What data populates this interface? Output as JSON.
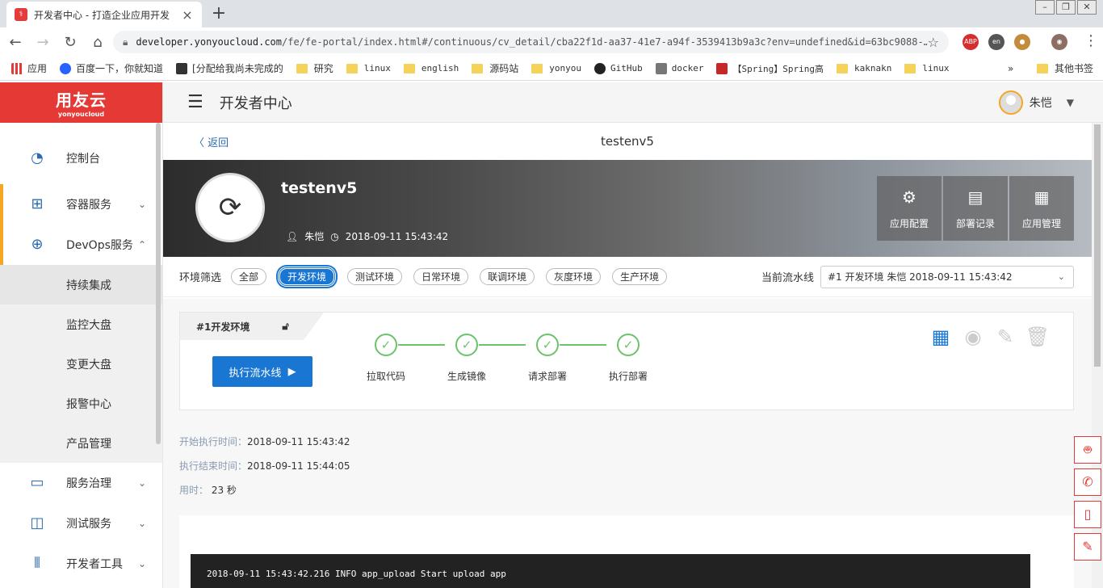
{
  "browser": {
    "tab_title": "开发者中心 - 打造企业应用开发",
    "tab_favicon": "app-favicon",
    "new_tab": "+",
    "url_domain": "developer.yonyoucloud.com",
    "url_path": "/fe/fe-portal/index.html#/continuous/cv_detail/cba22f1d-aa37-41e7-a94f-3539413b9a3c?env=undefined&id=63bc9088-…",
    "bookmarks": [
      {
        "label": "应用",
        "type": "apps"
      },
      {
        "label": "百度一下，你就知道",
        "type": "site"
      },
      {
        "label": "[分配给我尚未完成的",
        "type": "site"
      },
      {
        "label": "研究",
        "type": "folder"
      },
      {
        "label": "linux",
        "type": "folder"
      },
      {
        "label": "english",
        "type": "folder"
      },
      {
        "label": "源码站",
        "type": "folder"
      },
      {
        "label": "yonyou",
        "type": "folder"
      },
      {
        "label": "GitHub",
        "type": "site"
      },
      {
        "label": "docker",
        "type": "site"
      },
      {
        "label": "【Spring】Spring高",
        "type": "site"
      },
      {
        "label": "kaknakn",
        "type": "folder"
      },
      {
        "label": "linux",
        "type": "folder"
      }
    ],
    "more_bookmarks": "»",
    "other_bookmarks": "其他书签"
  },
  "sidebar": {
    "logo_main": "用友云",
    "logo_sub": "yonyoucloud",
    "items": [
      {
        "label": "控制台",
        "icon": "dashboard-icon",
        "expandable": false
      },
      {
        "label": "容器服务",
        "icon": "container-icon",
        "expandable": true
      },
      {
        "label": "DevOps服务",
        "icon": "devops-icon",
        "expandable": true,
        "expanded": true
      }
    ],
    "sub_items": [
      {
        "label": "持续集成",
        "selected": true
      },
      {
        "label": "监控大盘"
      },
      {
        "label": "变更大盘"
      },
      {
        "label": "报警中心"
      },
      {
        "label": "产品管理"
      }
    ],
    "items_after": [
      {
        "label": "服务治理",
        "icon": "laptop-icon"
      },
      {
        "label": "测试服务",
        "icon": "bag-icon"
      },
      {
        "label": "开发者工具",
        "icon": "tools-icon"
      }
    ]
  },
  "header": {
    "title": "开发者中心",
    "user_name": "朱恺"
  },
  "page": {
    "back_label": "返回",
    "title": "testenv5",
    "app_name": "testenv5",
    "owner": "朱恺",
    "created": "2018-09-11 15:43:42",
    "actions": [
      {
        "label": "应用配置",
        "icon": "gear-icon"
      },
      {
        "label": "部署记录",
        "icon": "doc-icon"
      },
      {
        "label": "应用管理",
        "icon": "grid-icon"
      }
    ]
  },
  "filter": {
    "label": "环境筛选",
    "chips": [
      "全部",
      "开发环境",
      "测试环境",
      "日常环境",
      "联调环境",
      "灰度环境",
      "生产环境"
    ],
    "active": "开发环境",
    "pipeline_label": "当前流水线",
    "pipeline_value": "#1 开发环境 朱恺 2018-09-11 15:43:42"
  },
  "pipeline": {
    "tab_label": "#1开发环境",
    "run_label": "执行流水线",
    "steps": [
      "拉取代码",
      "生成镜像",
      "请求部署",
      "执行部署"
    ],
    "step_status": "success"
  },
  "info": {
    "start_label": "开始执行时间：",
    "start_value": "2018-09-11 15:43:42",
    "end_label": "执行结束时间：",
    "end_value": "2018-09-11 15:44:05",
    "duration_label": "用时：",
    "duration_value": "23 秒"
  },
  "log": {
    "line1": "2018-09-11 15:43:42.216 INFO app_upload Start upload app"
  },
  "colors": {
    "brand_red": "#e53935",
    "primary_blue": "#1976d2",
    "accent_orange": "#f5a623",
    "success_green": "#6cc36c"
  }
}
